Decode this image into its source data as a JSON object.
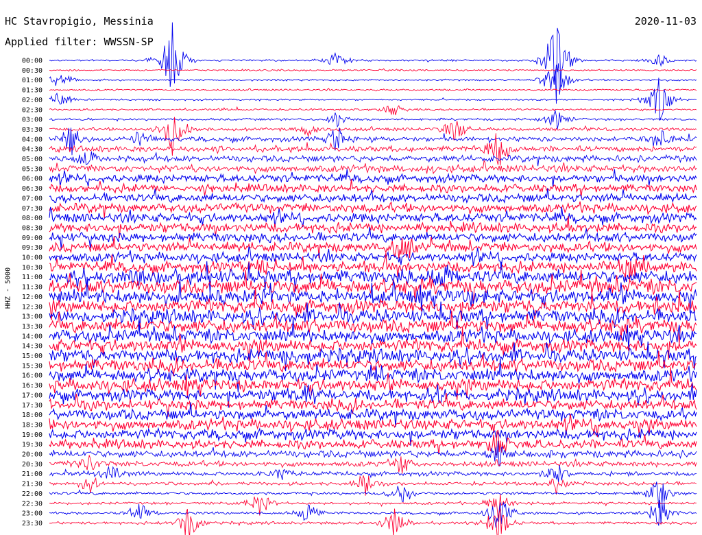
{
  "header": {
    "station": "HC Stavropigio, Messinia",
    "filter": "Applied filter: WWSSN-SP",
    "date": "2020-11-03",
    "channel": "HHZ - 5000"
  },
  "colors": {
    "blue": "#0000ee",
    "red": "#ff0033"
  },
  "chart_data": {
    "type": "line",
    "title": "",
    "ylabel": "HHZ - 5000",
    "row_labels": [
      "00:00",
      "00:30",
      "01:00",
      "01:30",
      "02:00",
      "02:30",
      "03:00",
      "03:30",
      "04:00",
      "04:30",
      "05:00",
      "05:30",
      "06:00",
      "06:30",
      "07:00",
      "07:30",
      "08:00",
      "08:30",
      "09:00",
      "09:30",
      "10:00",
      "10:30",
      "11:00",
      "11:30",
      "12:00",
      "12:30",
      "13:00",
      "13:30",
      "14:00",
      "14:30",
      "15:00",
      "15:30",
      "16:00",
      "16:30",
      "17:00",
      "17:30",
      "18:00",
      "18:30",
      "19:00",
      "19:30",
      "20:00",
      "20:30",
      "21:00",
      "21:30",
      "22:00",
      "22:30",
      "23:00",
      "23:30"
    ],
    "row_colors": [
      "blue",
      "red"
    ],
    "noise_level": [
      1,
      1,
      1,
      1,
      1,
      1.2,
      1.3,
      1.8,
      2.8,
      3.2,
      3.6,
      4,
      4.5,
      4.5,
      4.8,
      5,
      5.3,
      5.3,
      5.3,
      5.3,
      5.3,
      6,
      7.5,
      8,
      8,
      7.5,
      7.5,
      7.5,
      7.2,
      7.2,
      7.2,
      7,
      7,
      7,
      6.5,
      6,
      6,
      6,
      5.8,
      5,
      4,
      3,
      2.5,
      2,
      1.7,
      1.5,
      1.5,
      1.5
    ],
    "x_range_minutes": [
      0,
      30
    ],
    "events": [
      {
        "row": 0,
        "t": 0.1908,
        "amp": 60
      },
      {
        "row": 0,
        "t": 0.4443,
        "amp": 18
      },
      {
        "row": 0,
        "t": 0.7826,
        "amp": 70
      },
      {
        "row": 0,
        "t": 0.9425,
        "amp": 12
      },
      {
        "row": 2,
        "t": 0.0174,
        "amp": 18
      },
      {
        "row": 2,
        "t": 0.7826,
        "amp": 40
      },
      {
        "row": 4,
        "t": 0.0174,
        "amp": 14
      },
      {
        "row": 4,
        "t": 0.9425,
        "amp": 35
      },
      {
        "row": 5,
        "t": 0.5323,
        "amp": 12
      },
      {
        "row": 6,
        "t": 0.4443,
        "amp": 14
      },
      {
        "row": 6,
        "t": 0.7826,
        "amp": 18
      },
      {
        "row": 7,
        "t": 0.1908,
        "amp": 40
      },
      {
        "row": 7,
        "t": 0.3998,
        "amp": 12
      },
      {
        "row": 7,
        "t": 0.6266,
        "amp": 22
      },
      {
        "row": 8,
        "t": 0.0331,
        "amp": 28
      },
      {
        "row": 8,
        "t": 0.1389,
        "amp": 14
      },
      {
        "row": 8,
        "t": 0.4443,
        "amp": 20
      },
      {
        "row": 8,
        "t": 0.9425,
        "amp": 22
      },
      {
        "row": 9,
        "t": 0.6929,
        "amp": 30
      },
      {
        "row": 10,
        "t": 0.0621,
        "amp": 16
      },
      {
        "row": 19,
        "t": 0.5447,
        "amp": 28
      },
      {
        "row": 21,
        "t": 0.3258,
        "amp": 18
      },
      {
        "row": 21,
        "t": 0.8972,
        "amp": 22
      },
      {
        "row": 22,
        "t": 0.1389,
        "amp": 20
      },
      {
        "row": 22,
        "t": 0.606,
        "amp": 22
      },
      {
        "row": 34,
        "t": 0.3998,
        "amp": 22
      },
      {
        "row": 34,
        "t": 0.606,
        "amp": 18
      },
      {
        "row": 39,
        "t": 0.6929,
        "amp": 24
      },
      {
        "row": 40,
        "t": 0.6929,
        "amp": 28
      },
      {
        "row": 41,
        "t": 0.0621,
        "amp": 16
      },
      {
        "row": 41,
        "t": 0.5447,
        "amp": 18
      },
      {
        "row": 42,
        "t": 0.0941,
        "amp": 18
      },
      {
        "row": 42,
        "t": 0.36,
        "amp": 14
      },
      {
        "row": 42,
        "t": 0.7826,
        "amp": 22
      },
      {
        "row": 43,
        "t": 0.0621,
        "amp": 16
      },
      {
        "row": 43,
        "t": 0.488,
        "amp": 18
      },
      {
        "row": 43,
        "t": 0.7826,
        "amp": 16
      },
      {
        "row": 44,
        "t": 0.5447,
        "amp": 18
      },
      {
        "row": 44,
        "t": 0.9425,
        "amp": 26
      },
      {
        "row": 45,
        "t": 0.3258,
        "amp": 22
      },
      {
        "row": 45,
        "t": 0.6929,
        "amp": 22
      },
      {
        "row": 46,
        "t": 0.1389,
        "amp": 18
      },
      {
        "row": 46,
        "t": 0.3998,
        "amp": 22
      },
      {
        "row": 46,
        "t": 0.6929,
        "amp": 36
      },
      {
        "row": 46,
        "t": 0.9425,
        "amp": 28
      },
      {
        "row": 47,
        "t": 0.2144,
        "amp": 30
      },
      {
        "row": 47,
        "t": 0.5323,
        "amp": 26
      },
      {
        "row": 47,
        "t": 0.6929,
        "amp": 32
      }
    ]
  }
}
